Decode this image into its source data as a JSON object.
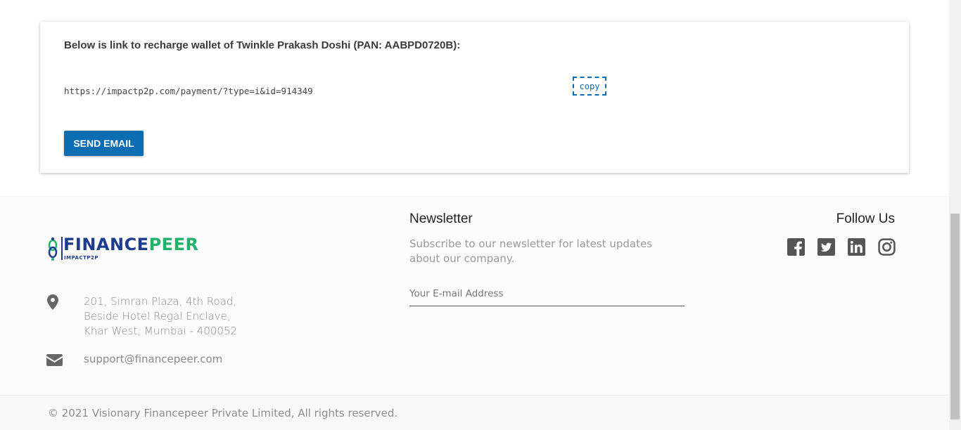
{
  "card": {
    "title": "Below is link to recharge wallet of Twinkle Prakash Doshi (PAN: AABPD0720B):",
    "link": "https://impactp2p.com/payment/?type=i&id=914349",
    "copy_label": "copy",
    "send_label": "SEND EMAIL"
  },
  "footer": {
    "logo": {
      "word_part1": "FINANCE",
      "word_part2": "PEER",
      "sub": "IMPACTP2P"
    },
    "address": [
      "201, Simran Plaza, 4th Road,",
      "Beside Hotel Regal Enclave,",
      "Khar West, Mumbai - 400052"
    ],
    "email": "support@financepeer.com",
    "newsletter": {
      "title": "Newsletter",
      "description": "Subscribe to our newsletter for latest updates about our company.",
      "placeholder": "Your E-mail Address"
    },
    "follow": {
      "title": "Follow Us",
      "icons": [
        "facebook-icon",
        "twitter-icon",
        "linkedin-icon",
        "instagram-icon"
      ]
    },
    "copyright": "© 2021 Visionary Financepeer Private Limited, All rights reserved."
  },
  "colors": {
    "primary": "#0b6eb3",
    "brand_blue": "#1e3c8e",
    "brand_green": "#22b16a"
  }
}
